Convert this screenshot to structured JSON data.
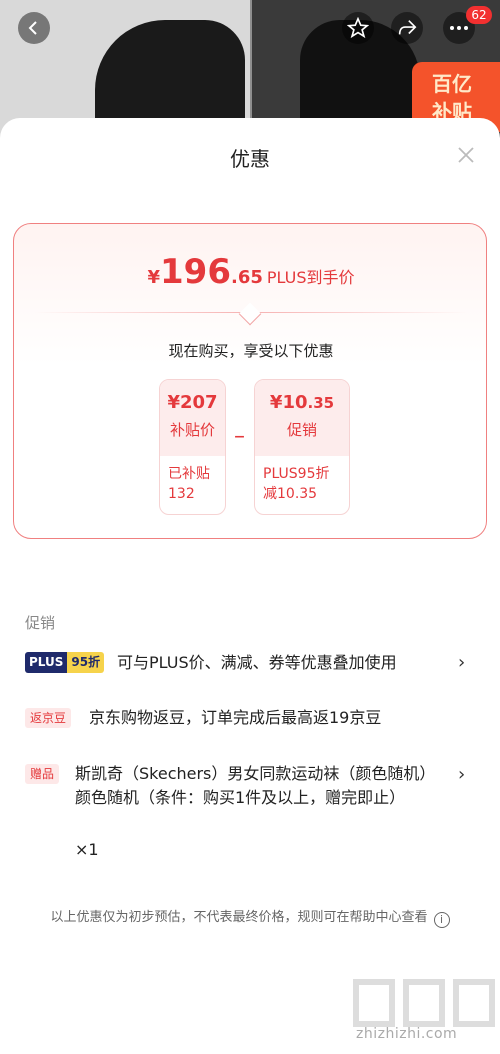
{
  "top": {
    "promo_badge_line1": "百亿",
    "promo_badge_line2": "补贴",
    "notification_count": "62"
  },
  "sheet": {
    "title": "优惠",
    "price": {
      "currency": "¥",
      "integer": "196",
      "decimal": ".65",
      "suffix": "PLUS到手价"
    },
    "subheading": "现在购买，享受以下优惠",
    "subsidy": {
      "value": "¥207",
      "label": "补贴价",
      "detail_line1": "已补贴",
      "detail_line2": "132"
    },
    "minus_sign": "–",
    "promo": {
      "value_prefix": "¥10",
      "value_decimal": ".35",
      "label": "促销",
      "detail_line1": "PLUS95折",
      "detail_line2": "减10.35"
    }
  },
  "promotions": {
    "section_label": "促销",
    "items": [
      {
        "tag_a": "PLUS",
        "tag_b": "95折",
        "text": "可与PLUS价、满减、券等优惠叠加使用",
        "has_chevron": true
      },
      {
        "tag": "返京豆",
        "text": "京东购物返豆，订单完成后最高返19京豆",
        "has_chevron": false
      },
      {
        "tag": "赠品",
        "text": "斯凯奇（Skechers）男女同款运动袜（颜色随机）颜色随机（条件：购买1件及以上，赠完即止）",
        "quantity": "×1",
        "has_chevron": true
      }
    ]
  },
  "footer": {
    "note": "以上优惠仅为初步预估，不代表最终价格，规则可在帮助中心查看"
  },
  "watermark": {
    "text": "zhizhizhi.com"
  },
  "colors": {
    "accent": "#e4393c",
    "plus_dark": "#1f2a6b",
    "plus_gold": "#f6d34b"
  }
}
